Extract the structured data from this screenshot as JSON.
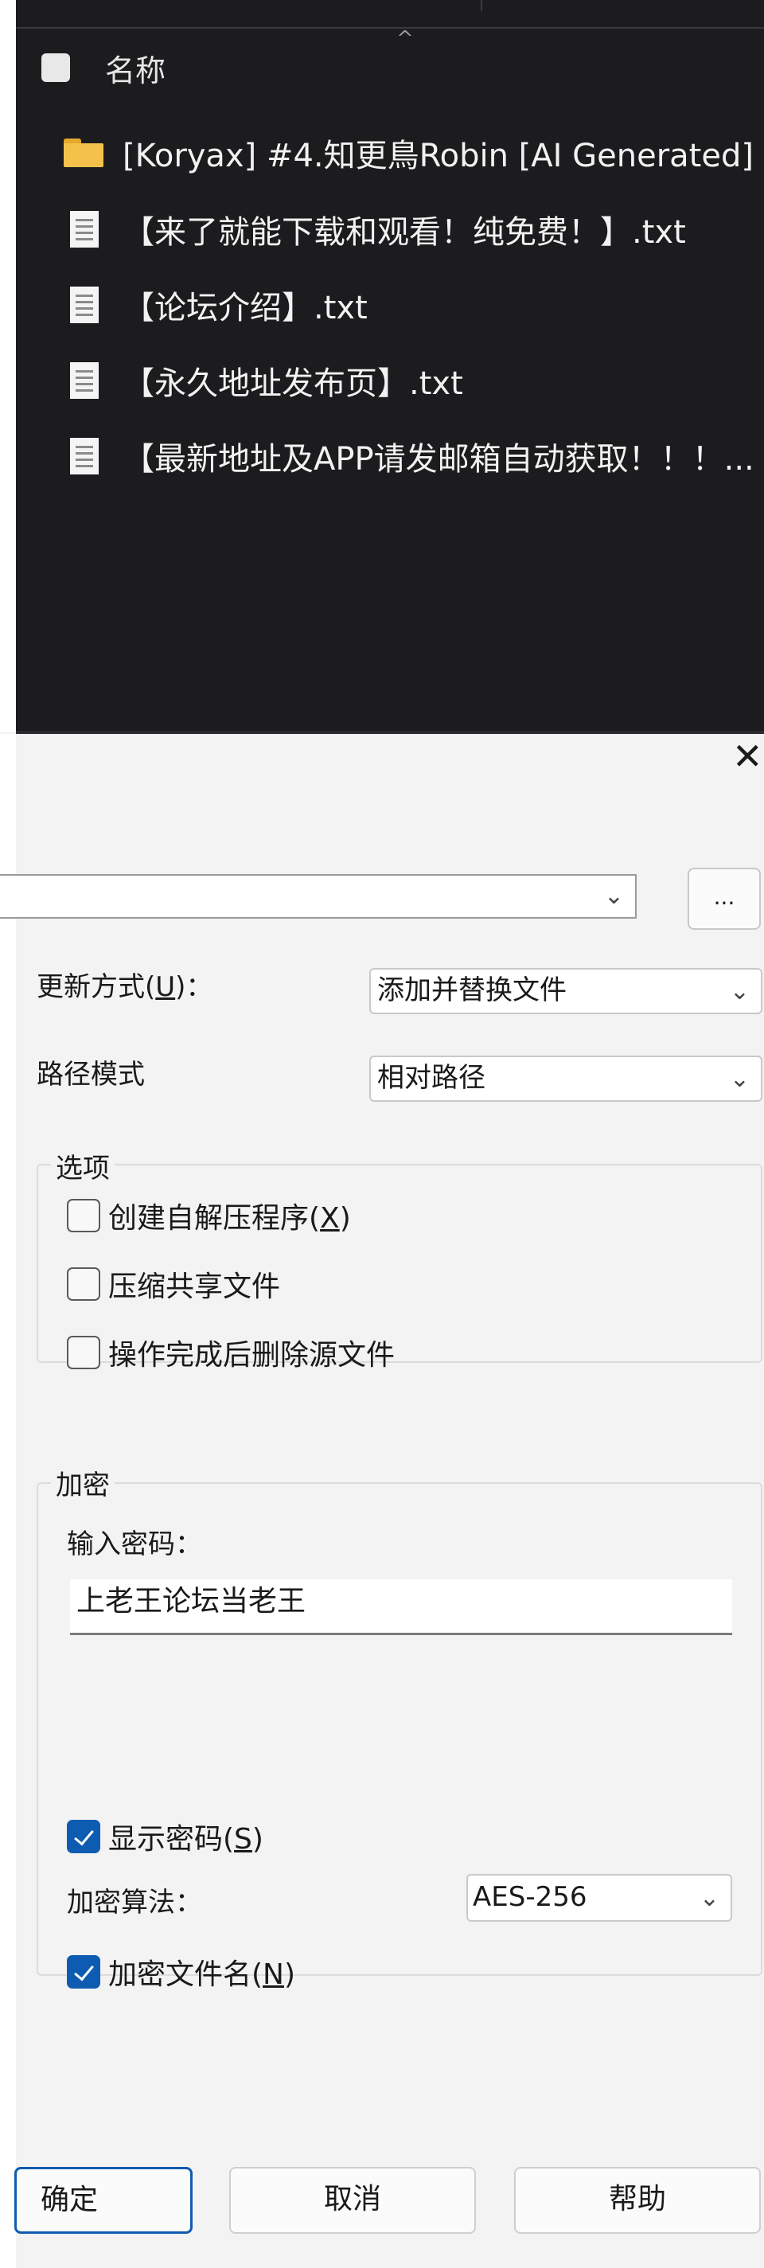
{
  "file_list": {
    "header": {
      "name_col": "名称"
    },
    "items": [
      {
        "type": "folder",
        "name": "[Koryax] #4.知更鳥Robin [AI Generated]"
      },
      {
        "type": "txt",
        "name": "【来了就能下载和观看！纯免费！】.txt"
      },
      {
        "type": "txt",
        "name": "【论坛介绍】.txt"
      },
      {
        "type": "txt",
        "name": "【永久地址发布页】.txt"
      },
      {
        "type": "txt",
        "name": "【最新地址及APP请发邮箱自动获取！！！..."
      }
    ]
  },
  "dialog": {
    "close_glyph": "✕",
    "path": {
      "value": "",
      "browse_label": "..."
    },
    "update_mode": {
      "label": "更新方式(",
      "accel": "U",
      "label_tail": ")：",
      "value": "添加并替换文件"
    },
    "path_mode": {
      "label": "路径模式",
      "value": "相对路径"
    },
    "options": {
      "title": "选项",
      "items": [
        {
          "label": "创建自解压程序(",
          "accel": "X",
          "tail": ")",
          "checked": false
        },
        {
          "label": "压缩共享文件",
          "accel": "",
          "tail": "",
          "checked": false
        },
        {
          "label": "操作完成后删除源文件",
          "accel": "",
          "tail": "",
          "checked": false
        }
      ]
    },
    "encryption": {
      "title": "加密",
      "password_label": "输入密码：",
      "password_value": "上老王论坛当老王",
      "show_password": {
        "label": "显示密码(",
        "accel": "S",
        "tail": ")",
        "checked": true
      },
      "algo_label": "加密算法：",
      "algo_value": "AES-256",
      "encrypt_names": {
        "label": "加密文件名(",
        "accel": "N",
        "tail": ")",
        "checked": true
      }
    },
    "buttons": {
      "ok": "确定",
      "cancel": "取消",
      "help": "帮助"
    }
  },
  "colors": {
    "dark_bg": "#1c1c1e",
    "accent": "#0e5cb1",
    "folder": "#f4c24a"
  }
}
